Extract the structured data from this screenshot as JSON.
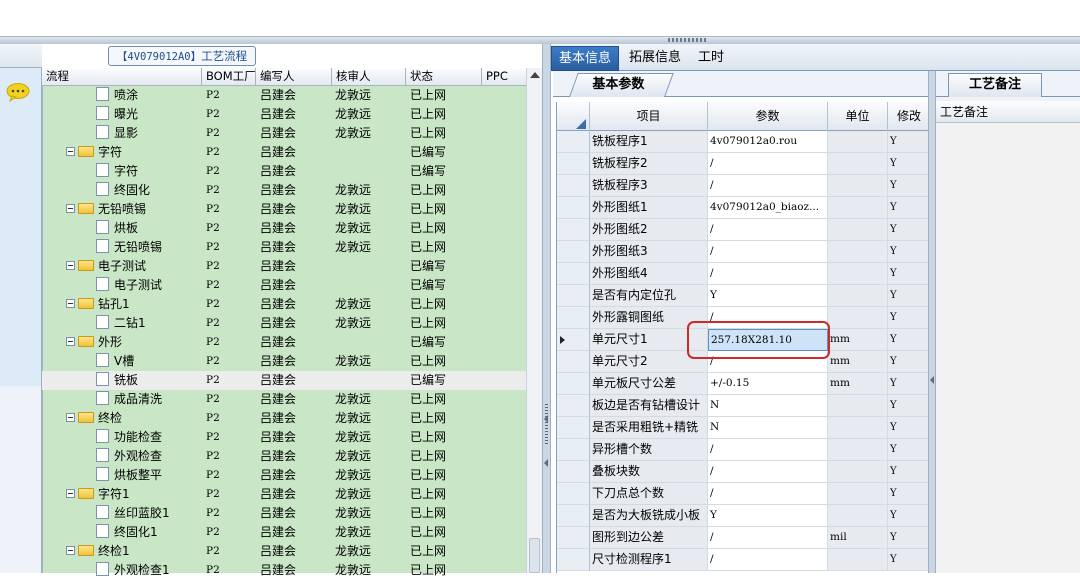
{
  "process_group": {
    "code": "【4V079012A0】",
    "label": "工艺流程"
  },
  "tree": {
    "columns": [
      "流程",
      "BOM工厂",
      "编写人",
      "核审人",
      "状态",
      "PPC"
    ],
    "rows": [
      {
        "name": "喷涂",
        "kind": "leaf",
        "bom": "P2",
        "writer": "吕建会",
        "reviewer": "龙敦远",
        "status": "已上网"
      },
      {
        "name": "曝光",
        "kind": "leaf",
        "bom": "P2",
        "writer": "吕建会",
        "reviewer": "龙敦远",
        "status": "已上网"
      },
      {
        "name": "显影",
        "kind": "leaf",
        "bom": "P2",
        "writer": "吕建会",
        "reviewer": "龙敦远",
        "status": "已上网"
      },
      {
        "name": "字符",
        "kind": "folder",
        "bom": "P2",
        "writer": "吕建会",
        "reviewer": "",
        "status": "已编写"
      },
      {
        "name": "字符",
        "kind": "leaf",
        "bom": "P2",
        "writer": "吕建会",
        "reviewer": "",
        "status": "已编写"
      },
      {
        "name": "终固化",
        "kind": "leaf",
        "bom": "P2",
        "writer": "吕建会",
        "reviewer": "龙敦远",
        "status": "已上网"
      },
      {
        "name": "无铅喷锡",
        "kind": "folder",
        "bom": "P2",
        "writer": "吕建会",
        "reviewer": "龙敦远",
        "status": "已上网"
      },
      {
        "name": "烘板",
        "kind": "leaf",
        "bom": "P2",
        "writer": "吕建会",
        "reviewer": "龙敦远",
        "status": "已上网"
      },
      {
        "name": "无铅喷锡",
        "kind": "leaf",
        "bom": "P2",
        "writer": "吕建会",
        "reviewer": "龙敦远",
        "status": "已上网"
      },
      {
        "name": "电子测试",
        "kind": "folder",
        "bom": "P2",
        "writer": "吕建会",
        "reviewer": "",
        "status": "已编写"
      },
      {
        "name": "电子测试",
        "kind": "leaf",
        "bom": "P2",
        "writer": "吕建会",
        "reviewer": "",
        "status": "已编写"
      },
      {
        "name": "钻孔1",
        "kind": "folder",
        "bom": "P2",
        "writer": "吕建会",
        "reviewer": "龙敦远",
        "status": "已上网"
      },
      {
        "name": "二钻1",
        "kind": "leaf",
        "bom": "P2",
        "writer": "吕建会",
        "reviewer": "龙敦远",
        "status": "已上网"
      },
      {
        "name": "外形",
        "kind": "folder",
        "bom": "P2",
        "writer": "吕建会",
        "reviewer": "",
        "status": "已编写"
      },
      {
        "name": "V槽",
        "kind": "leaf",
        "bom": "P2",
        "writer": "吕建会",
        "reviewer": "龙敦远",
        "status": "已上网"
      },
      {
        "name": "铣板",
        "kind": "leaf",
        "bom": "P2",
        "writer": "吕建会",
        "reviewer": "",
        "status": "已编写",
        "selected": true
      },
      {
        "name": "成品清洗",
        "kind": "leaf",
        "bom": "P2",
        "writer": "吕建会",
        "reviewer": "龙敦远",
        "status": "已上网"
      },
      {
        "name": "终检",
        "kind": "folder",
        "bom": "P2",
        "writer": "吕建会",
        "reviewer": "龙敦远",
        "status": "已上网"
      },
      {
        "name": "功能检查",
        "kind": "leaf",
        "bom": "P2",
        "writer": "吕建会",
        "reviewer": "龙敦远",
        "status": "已上网"
      },
      {
        "name": "外观检查",
        "kind": "leaf",
        "bom": "P2",
        "writer": "吕建会",
        "reviewer": "龙敦远",
        "status": "已上网"
      },
      {
        "name": "烘板整平",
        "kind": "leaf",
        "bom": "P2",
        "writer": "吕建会",
        "reviewer": "龙敦远",
        "status": "已上网"
      },
      {
        "name": "字符1",
        "kind": "folder",
        "bom": "P2",
        "writer": "吕建会",
        "reviewer": "龙敦远",
        "status": "已上网"
      },
      {
        "name": "丝印蓝胶1",
        "kind": "leaf",
        "bom": "P2",
        "writer": "吕建会",
        "reviewer": "龙敦远",
        "status": "已上网"
      },
      {
        "name": "终固化1",
        "kind": "leaf",
        "bom": "P2",
        "writer": "吕建会",
        "reviewer": "龙敦远",
        "status": "已上网"
      },
      {
        "name": "终检1",
        "kind": "folder",
        "bom": "P2",
        "writer": "吕建会",
        "reviewer": "龙敦远",
        "status": "已上网"
      },
      {
        "name": "外观检查1",
        "kind": "leaf",
        "bom": "P2",
        "writer": "吕建会",
        "reviewer": "龙敦远",
        "status": "已上网"
      }
    ]
  },
  "tabs": {
    "basic": "基本信息",
    "extended": "拓展信息",
    "hours": "工时"
  },
  "subtab": "基本参数",
  "grid": {
    "headers": {
      "item": "项目",
      "param": "参数",
      "unit": "单位",
      "modify": "修改"
    },
    "rows": [
      {
        "item": "铣板程序1",
        "param": "4v079012a0.rou",
        "unit": "",
        "modify": "Y"
      },
      {
        "item": "铣板程序2",
        "param": "/",
        "unit": "",
        "modify": "Y"
      },
      {
        "item": "铣板程序3",
        "param": "/",
        "unit": "",
        "modify": "Y"
      },
      {
        "item": "外形图纸1",
        "param": "4v079012a0_biaoz...",
        "unit": "",
        "modify": "Y"
      },
      {
        "item": "外形图纸2",
        "param": "/",
        "unit": "",
        "modify": "Y"
      },
      {
        "item": "外形图纸3",
        "param": "/",
        "unit": "",
        "modify": "Y"
      },
      {
        "item": "外形图纸4",
        "param": "/",
        "unit": "",
        "modify": "Y"
      },
      {
        "item": "是否有内定位孔",
        "param": "Y",
        "unit": "",
        "modify": "Y"
      },
      {
        "item": "外形露铜图纸",
        "param": "/",
        "unit": "",
        "modify": "Y"
      },
      {
        "item": "单元尺寸1",
        "param": "257.18X281.10",
        "unit": "mm",
        "modify": "Y",
        "current": true
      },
      {
        "item": "单元尺寸2",
        "param": "/",
        "unit": "mm",
        "modify": "Y"
      },
      {
        "item": "单元板尺寸公差",
        "param": "+/-0.15",
        "unit": "mm",
        "modify": "Y"
      },
      {
        "item": "板边是否有钻槽设计",
        "param": "N",
        "unit": "",
        "modify": "Y"
      },
      {
        "item": "是否采用粗铣+精铣",
        "param": "N",
        "unit": "",
        "modify": "Y"
      },
      {
        "item": "异形槽个数",
        "param": "/",
        "unit": "",
        "modify": "Y"
      },
      {
        "item": "叠板块数",
        "param": "/",
        "unit": "",
        "modify": "Y"
      },
      {
        "item": "下刀点总个数",
        "param": "/",
        "unit": "",
        "modify": "Y"
      },
      {
        "item": "是否为大板铣成小板",
        "param": "Y",
        "unit": "",
        "modify": "Y"
      },
      {
        "item": "图形到边公差",
        "param": "/",
        "unit": "mil",
        "modify": "Y"
      },
      {
        "item": "尺寸检测程序1",
        "param": "/",
        "unit": "",
        "modify": "Y"
      }
    ]
  },
  "notes": {
    "tab": "工艺备注",
    "header": "工艺备注"
  },
  "colors": {
    "tree_bg": "#c9e7c7",
    "tab_active": "#2f6db5",
    "highlight_ring": "#d12828"
  }
}
